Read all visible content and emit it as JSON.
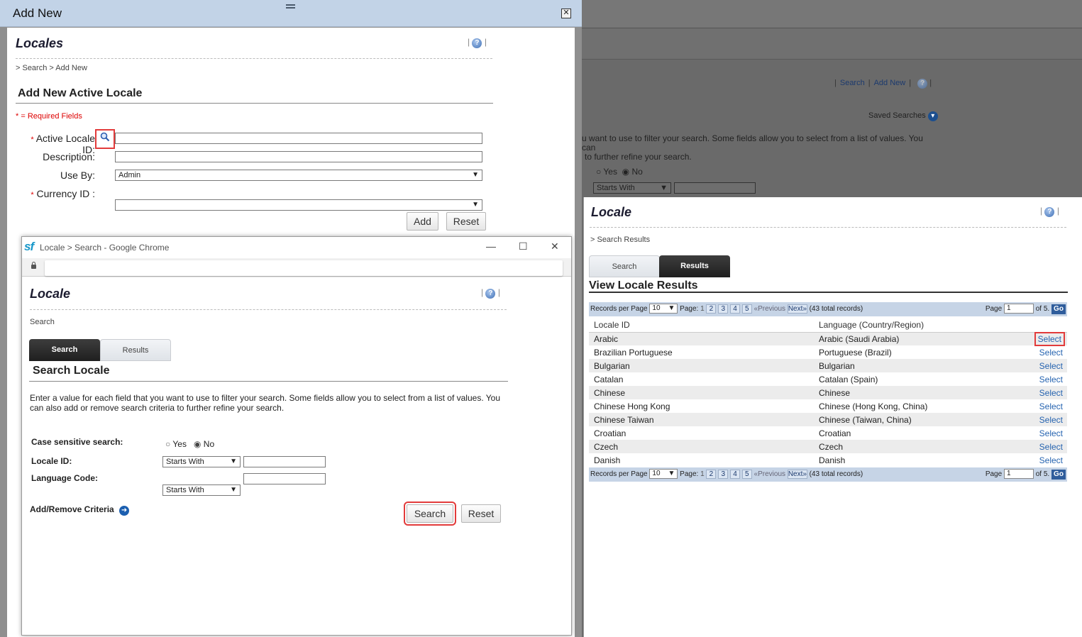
{
  "background_page": {
    "links": [
      "Search",
      "Add New"
    ],
    "saved_searches": "Saved Searches",
    "text_line1": "u want to use to filter your search. Some fields allow you to select from a list of values. You can",
    "text_line2": "to further refine your search.",
    "radio_yes": "Yes",
    "radio_no": "No",
    "select_value": "Starts With"
  },
  "add_new_dialog": {
    "title": "Add New",
    "page_title": "Locales",
    "breadcrumb": "> Search > Add New",
    "section_title": "Add New Active Locale",
    "required_note": "* = Required Fields",
    "fields": {
      "active_locale_id": "Active Locale ID:",
      "description": "Description:",
      "use_by": "Use By:",
      "use_by_value": "Admin",
      "currency_id": "Currency ID :",
      "currency_value": ""
    },
    "add_button": "Add",
    "reset_button": "Reset",
    "required_star": "*"
  },
  "popup": {
    "window_title": "Locale > Search - Google Chrome",
    "logo": "sf",
    "page_title": "Locale",
    "breadcrumb": "Search",
    "tabs": [
      "Search",
      "Results"
    ],
    "section_title": "Search Locale",
    "instructions": "Enter a value for each field that you want to use to filter your search. Some fields allow you to select from a list of values. You can also add or remove search criteria to further refine your search.",
    "case_sensitive_label": "Case sensitive search:",
    "radio_yes": "Yes",
    "radio_no": "No",
    "locale_id_label": "Locale ID:",
    "language_code_label": "Language Code:",
    "operator_value": "Starts With",
    "add_remove_criteria": "Add/Remove Criteria",
    "search_button": "Search",
    "reset_button": "Reset"
  },
  "results": {
    "page_title": "Locale",
    "breadcrumb": "> Search Results",
    "tabs": [
      "Search",
      "Results"
    ],
    "section_title": "View Locale Results",
    "pager": {
      "records_per_page_label": "Records per Page",
      "records_per_page": "10",
      "page_label": "Page:",
      "current_page": "1",
      "pages": [
        "2",
        "3",
        "4",
        "5"
      ],
      "previous": "«Previous",
      "next": "Next»",
      "total": "(43 total records)",
      "page_input_label": "Page",
      "page_input_value": "1",
      "of_label": "of 5.",
      "go": "Go"
    },
    "columns": [
      "Locale ID",
      "Language (Country/Region)"
    ],
    "rows": [
      {
        "locale_id": "Arabic",
        "language": "Arabic (Saudi Arabia)",
        "action": "Select"
      },
      {
        "locale_id": "Brazilian Portuguese",
        "language": "Portuguese (Brazil)",
        "action": "Select"
      },
      {
        "locale_id": "Bulgarian",
        "language": "Bulgarian",
        "action": "Select"
      },
      {
        "locale_id": "Catalan",
        "language": "Catalan (Spain)",
        "action": "Select"
      },
      {
        "locale_id": "Chinese",
        "language": "Chinese",
        "action": "Select"
      },
      {
        "locale_id": "Chinese Hong Kong",
        "language": "Chinese (Hong Kong, China)",
        "action": "Select"
      },
      {
        "locale_id": "Chinese Taiwan",
        "language": "Chinese (Taiwan, China)",
        "action": "Select"
      },
      {
        "locale_id": "Croatian",
        "language": "Croatian",
        "action": "Select"
      },
      {
        "locale_id": "Czech",
        "language": "Czech",
        "action": "Select"
      },
      {
        "locale_id": "Danish",
        "language": "Danish",
        "action": "Select"
      }
    ]
  },
  "colors": {
    "dialog_titlebar": "#c2d3e7",
    "highlight": "#e23b3b",
    "link": "#2563b0",
    "pager": "#c6d4e6"
  }
}
